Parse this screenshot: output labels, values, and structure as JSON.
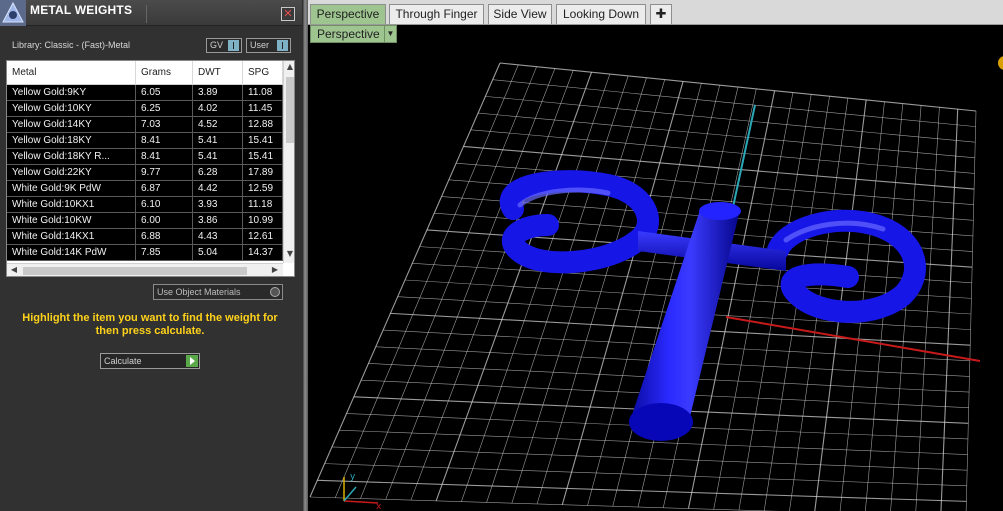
{
  "panel": {
    "title": "METAL WEIGHTS",
    "close_icon": "✕",
    "library_label": "Library: Classic - (Fast)-Metal",
    "gv_toggle": "GV",
    "user_toggle": "User",
    "use_object_materials": "Use Object Materials",
    "hint": "Highlight the item you want to find the weight for then press calculate.",
    "calculate_label": "Calculate",
    "table": {
      "headers": [
        "Metal",
        "Grams",
        "DWT",
        "SPG"
      ],
      "rows": [
        [
          "Yellow Gold:9KY",
          "6.05",
          "3.89",
          "11.08"
        ],
        [
          "Yellow Gold:10KY",
          "6.25",
          "4.02",
          "11.45"
        ],
        [
          "Yellow Gold:14KY",
          "7.03",
          "4.52",
          "12.88"
        ],
        [
          "Yellow Gold:18KY",
          "8.41",
          "5.41",
          "15.41"
        ],
        [
          "Yellow Gold:18KY R...",
          "8.41",
          "5.41",
          "15.41"
        ],
        [
          "Yellow Gold:22KY",
          "9.77",
          "6.28",
          "17.89"
        ],
        [
          "White Gold:9K PdW",
          "6.87",
          "4.42",
          "12.59"
        ],
        [
          "White Gold:10KX1",
          "6.10",
          "3.93",
          "11.18"
        ],
        [
          "White Gold:10KW",
          "6.00",
          "3.86",
          "10.99"
        ],
        [
          "White Gold:14KX1",
          "6.88",
          "4.43",
          "12.61"
        ],
        [
          "White Gold:14K PdW",
          "7.85",
          "5.04",
          "14.37"
        ]
      ]
    }
  },
  "viewport": {
    "tabs": [
      "Perspective",
      "Through Finger",
      "Side View",
      "Looking Down"
    ],
    "active_tab": "Perspective",
    "add_tab_icon": "✚",
    "view_dropdown": "Perspective",
    "axis_label_y": "y",
    "axis_label_x": "x",
    "model_color": "#1010e8",
    "grid_color": "#cfcfcf",
    "background": "#000000"
  }
}
